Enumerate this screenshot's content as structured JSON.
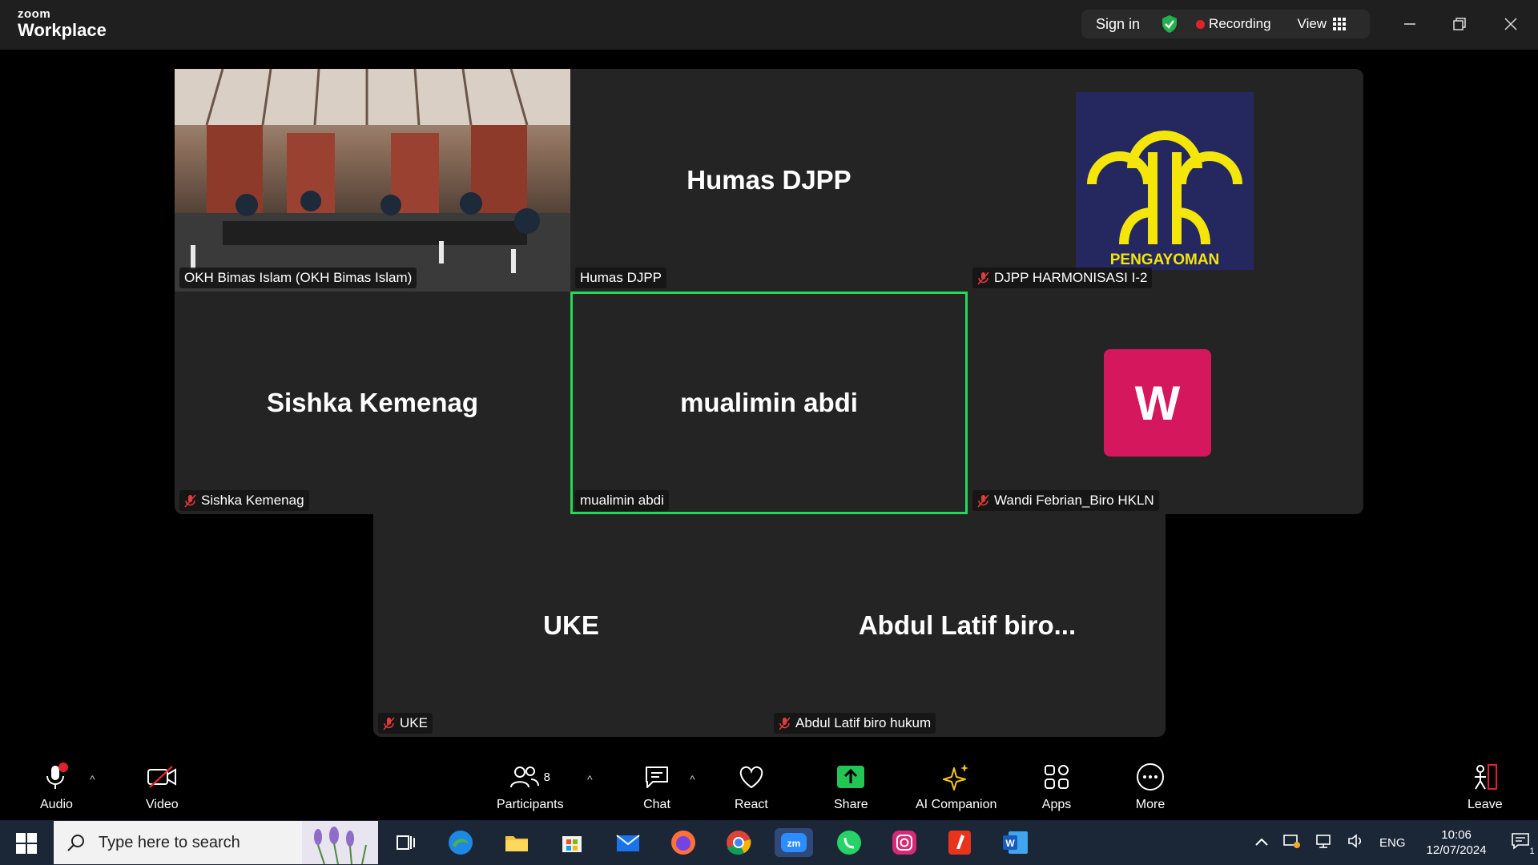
{
  "app": {
    "brand_top": "zoom",
    "brand_bottom": "Workplace"
  },
  "titlebar": {
    "signin": "Sign in",
    "recording": "Recording",
    "view": "View"
  },
  "tiles": [
    {
      "label": "OKH Bimas Islam (OKH Bimas Islam)",
      "bigname": ""
    },
    {
      "label": "Humas DJPP",
      "bigname": "Humas DJPP"
    },
    {
      "label": "DJPP HARMONISASI I-2",
      "bigname": "",
      "logo_text": "PENGAYOMAN"
    },
    {
      "label": "Sishka Kemenag",
      "bigname": "Sishka Kemenag"
    },
    {
      "label": "mualimin abdi",
      "bigname": "mualimin abdi"
    },
    {
      "label": "Wandi Febrian_Biro HKLN",
      "bigname": "",
      "avatar_letter": "W"
    },
    {
      "label": "UKE",
      "bigname": "UKE"
    },
    {
      "label": "Abdul Latif biro hukum",
      "bigname": "Abdul Latif biro..."
    }
  ],
  "toolbar": {
    "audio": "Audio",
    "video": "Video",
    "participants": "Participants",
    "participants_count": "8",
    "chat": "Chat",
    "react": "React",
    "share": "Share",
    "ai": "AI Companion",
    "apps": "Apps",
    "more": "More",
    "leave": "Leave"
  },
  "taskbar": {
    "search_placeholder": "Type here to search",
    "lang": "ENG",
    "time": "10:06",
    "date": "12/07/2024",
    "notif_count": "1"
  },
  "colors": {
    "active_border": "#23d959",
    "avatar": "#d5185e",
    "logo_bg": "#24285f",
    "logo_fg": "#f4e60b"
  }
}
